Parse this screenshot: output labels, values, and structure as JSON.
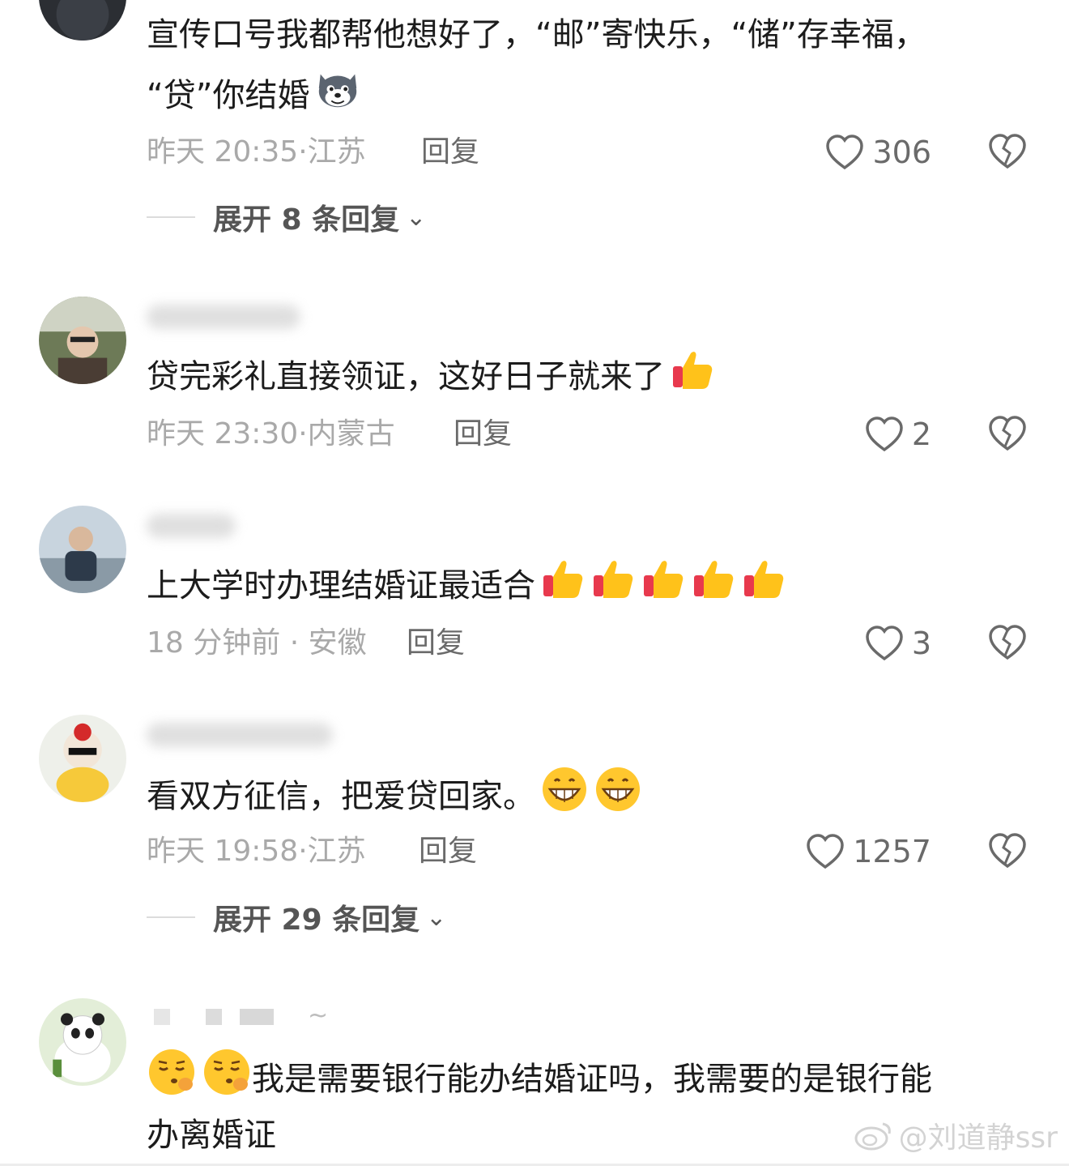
{
  "comments": [
    {
      "text_lines": [
        "宣传口号我都帮他想好了，“邮”寄快乐，“储”存幸福，",
        "“贷”你结婚"
      ],
      "emoji": "husky-face-emoji",
      "time": "昨天 20:35",
      "location": "江苏",
      "reply_label": "回复",
      "likes": "306",
      "expand_label": "展开 8 条回复"
    },
    {
      "text": "贷完彩礼直接领证，这好日子就来了",
      "emoji": "thumbs-up-emoji",
      "time": "昨天 23:30",
      "location": "内蒙古",
      "reply_label": "回复",
      "likes": "2"
    },
    {
      "text": "上大学时办理结婚证最适合",
      "emoji": "thumbs-up-emoji x5",
      "time": "18 分钟前",
      "location": "安徽",
      "reply_label": "回复",
      "likes": "3"
    },
    {
      "text": "看双方征信，把爱贷回家。",
      "emoji": "grinning-face-emoji x2",
      "time": "昨天 19:58",
      "location": "江苏",
      "reply_label": "回复",
      "likes": "1257",
      "expand_label": "展开 29 条回复"
    },
    {
      "name_suffix": "~",
      "text_lines": [
        "我是需要银行能办结婚证吗，我需要的是银行能",
        "办离婚证"
      ],
      "emoji": "relieved-face-emoji x2"
    }
  ],
  "meta_separator": "·",
  "watermark": "@刘道静ssr",
  "colors": {
    "text": "#1c1c1c",
    "meta": "#a9a9a9",
    "reply": "#6a6a6a",
    "background": "#ffffff"
  }
}
